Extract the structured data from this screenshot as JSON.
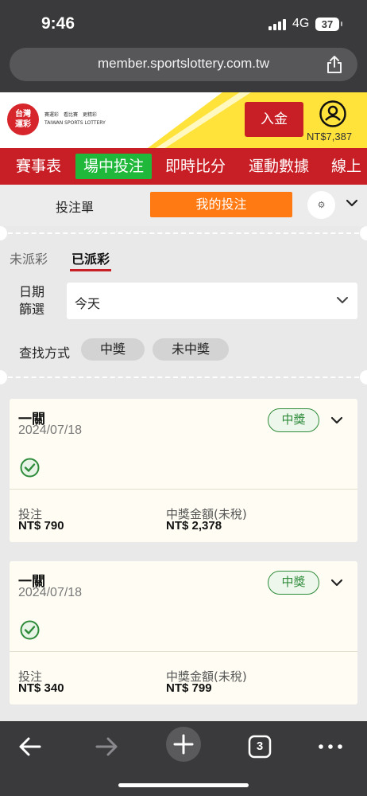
{
  "status_bar": {
    "time": "9:46",
    "network": "4G",
    "battery": "37"
  },
  "browser": {
    "url": "member.sportslottery.com.tw",
    "tabs_count": "3"
  },
  "header": {
    "logo_lines": [
      "台灣",
      "運彩"
    ],
    "logo_caption_zh": "賽運彩　看比賽　更精彩",
    "logo_caption_en": "TAIWAN SPORTS LOTTERY",
    "deposit_label": "入金",
    "balance": "NT$7,387"
  },
  "nav": {
    "items": [
      "賽事表",
      "場中投注",
      "即時比分",
      "運動數據",
      "線上"
    ],
    "active_index": 1
  },
  "tabs": {
    "bet_slip": "投注單",
    "my_bets": "我的投注",
    "settings_glyph": "⚙"
  },
  "filter": {
    "tabs": [
      "未派彩",
      "已派彩"
    ],
    "active_tab": 1,
    "date_label": "日期篩選",
    "date_value": "今天",
    "search_label": "查找方式",
    "search_options": [
      "中獎",
      "未中獎"
    ]
  },
  "bets": [
    {
      "type": "一關",
      "date": "2024/07/18",
      "status": "中獎",
      "stake_label": "投注",
      "stake": "NT$ 790",
      "payout_label": "中獎金額(未稅)",
      "payout": "NT$ 2,378"
    },
    {
      "type": "一關",
      "date": "2024/07/18",
      "status": "中獎",
      "stake_label": "投注",
      "stake": "NT$ 340",
      "payout_label": "中獎金額(未稅)",
      "payout": "NT$ 799"
    }
  ],
  "colors": {
    "brand_red": "#c81e25",
    "active_green": "#1fb83a",
    "orange": "#ff7a12",
    "win_green": "#2e8b3a"
  }
}
